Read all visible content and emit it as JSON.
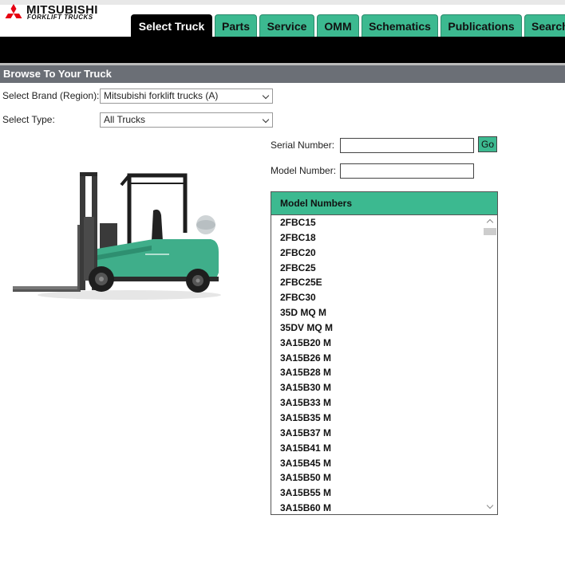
{
  "brand": {
    "name": "MITSUBISHI",
    "sub": "FORKLIFT TRUCKS",
    "logo_icon": "three-diamond-logo-icon"
  },
  "tabs": [
    {
      "label": "Select Truck",
      "active": true
    },
    {
      "label": "Parts"
    },
    {
      "label": "Service"
    },
    {
      "label": "OMM"
    },
    {
      "label": "Schematics"
    },
    {
      "label": "Publications"
    },
    {
      "label": "Search"
    }
  ],
  "browse": {
    "title": "Browse To Your Truck",
    "brand_label": "Select Brand (Region):",
    "brand_value": "Mitsubishi forklift trucks (A)",
    "type_label": "Select Type:",
    "type_value": "All Trucks"
  },
  "search": {
    "serial_label": "Serial Number:",
    "serial_value": "",
    "go_label": "Go",
    "model_label": "Model Number:",
    "model_value": ""
  },
  "models": {
    "header": "Model Numbers",
    "items": [
      "2FBC15",
      "2FBC18",
      "2FBC20",
      "2FBC25",
      "2FBC25E",
      "2FBC30",
      "35D MQ M",
      "35DV MQ M",
      "3A15B20 M",
      "3A15B26 M",
      "3A15B28 M",
      "3A15B30 M",
      "3A15B33 M",
      "3A15B35 M",
      "3A15B37 M",
      "3A15B41 M",
      "3A15B45 M",
      "3A15B50 M",
      "3A15B55 M",
      "3A15B60 M"
    ]
  },
  "colors": {
    "accent": "#3cb990",
    "header_bar": "#6b6f76",
    "logo_red": "#e60012"
  }
}
